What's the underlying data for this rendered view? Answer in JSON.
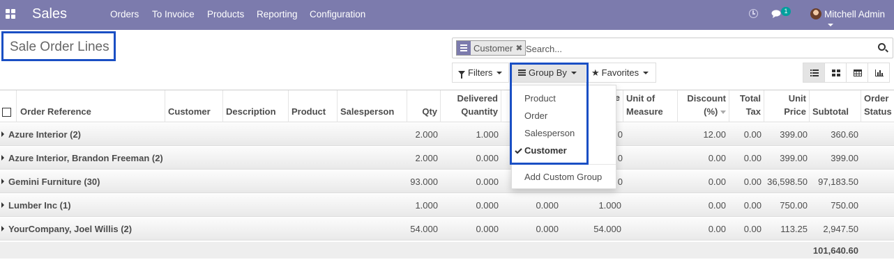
{
  "navbar": {
    "brand": "Sales",
    "menu": [
      "Orders",
      "To Invoice",
      "Products",
      "Reporting",
      "Configuration"
    ],
    "chat_badge": "1",
    "user": "Mitchell Admin",
    "icons": [
      "apps-grid-icon",
      "clock-icon",
      "chat-icon",
      "user-avatar"
    ]
  },
  "page": {
    "title": "Sale Order Lines"
  },
  "search": {
    "facet_value": "Customer",
    "placeholder": "Search..."
  },
  "toolbar": {
    "filters": "Filters",
    "group_by": "Group By",
    "favorites": "Favorites",
    "views": [
      "list-view",
      "kanban-view",
      "pivot-view",
      "graph-view"
    ],
    "active_view": "list-view"
  },
  "group_by_menu": {
    "items": [
      "Product",
      "Order",
      "Salesperson",
      "Customer"
    ],
    "selected": "Customer",
    "custom": "Add Custom Group"
  },
  "table": {
    "headers": {
      "order_reference": "Order Reference",
      "customer": "Customer",
      "description": "Description",
      "product": "Product",
      "salesperson": "Salesperson",
      "qty": "Qty",
      "delivered_1": "Delivered",
      "delivered_2": "Quantity",
      "invoiced_tail": "e",
      "uom_1": "Unit of",
      "uom_2": "Measure",
      "discount_1": "Discount",
      "discount_2": "(%)",
      "total_tax_1": "Total",
      "total_tax_2": "Tax",
      "unit_price_1": "Unit",
      "unit_price_2": "Price",
      "subtotal": "Subtotal",
      "status_1": "Order",
      "status_2": "Status"
    },
    "groups": [
      {
        "name": "Azure Interior (2)",
        "qty": "2.000",
        "delivered": "1.000",
        "invoiced": "",
        "to_invoice": "0",
        "discount": "12.00",
        "tax": "0.00",
        "unit_price": "399.00",
        "subtotal": "360.60"
      },
      {
        "name": "Azure Interior, Brandon Freeman (2)",
        "qty": "2.000",
        "delivered": "0.000",
        "invoiced": "",
        "to_invoice": "0",
        "discount": "0.00",
        "tax": "0.00",
        "unit_price": "399.00",
        "subtotal": "399.00"
      },
      {
        "name": "Gemini Furniture (30)",
        "qty": "93.000",
        "delivered": "0.000",
        "invoiced": "",
        "to_invoice": "0",
        "discount": "0.00",
        "tax": "0.00",
        "unit_price": "36,598.50",
        "subtotal": "97,183.50"
      },
      {
        "name": "Lumber Inc (1)",
        "qty": "1.000",
        "delivered": "0.000",
        "invoiced": "0.000",
        "to_invoice": "1.000",
        "discount": "0.00",
        "tax": "0.00",
        "unit_price": "750.00",
        "subtotal": "750.00"
      },
      {
        "name": "YourCompany, Joel Willis (2)",
        "qty": "54.000",
        "delivered": "0.000",
        "invoiced": "0.000",
        "to_invoice": "54.000",
        "discount": "0.00",
        "tax": "0.00",
        "unit_price": "113.25",
        "subtotal": "2,947.50"
      }
    ],
    "total_subtotal": "101,640.60"
  },
  "colors": {
    "navbar": "#7c7bad",
    "highlight": "#1a4fc4",
    "badge": "#00a09d"
  }
}
